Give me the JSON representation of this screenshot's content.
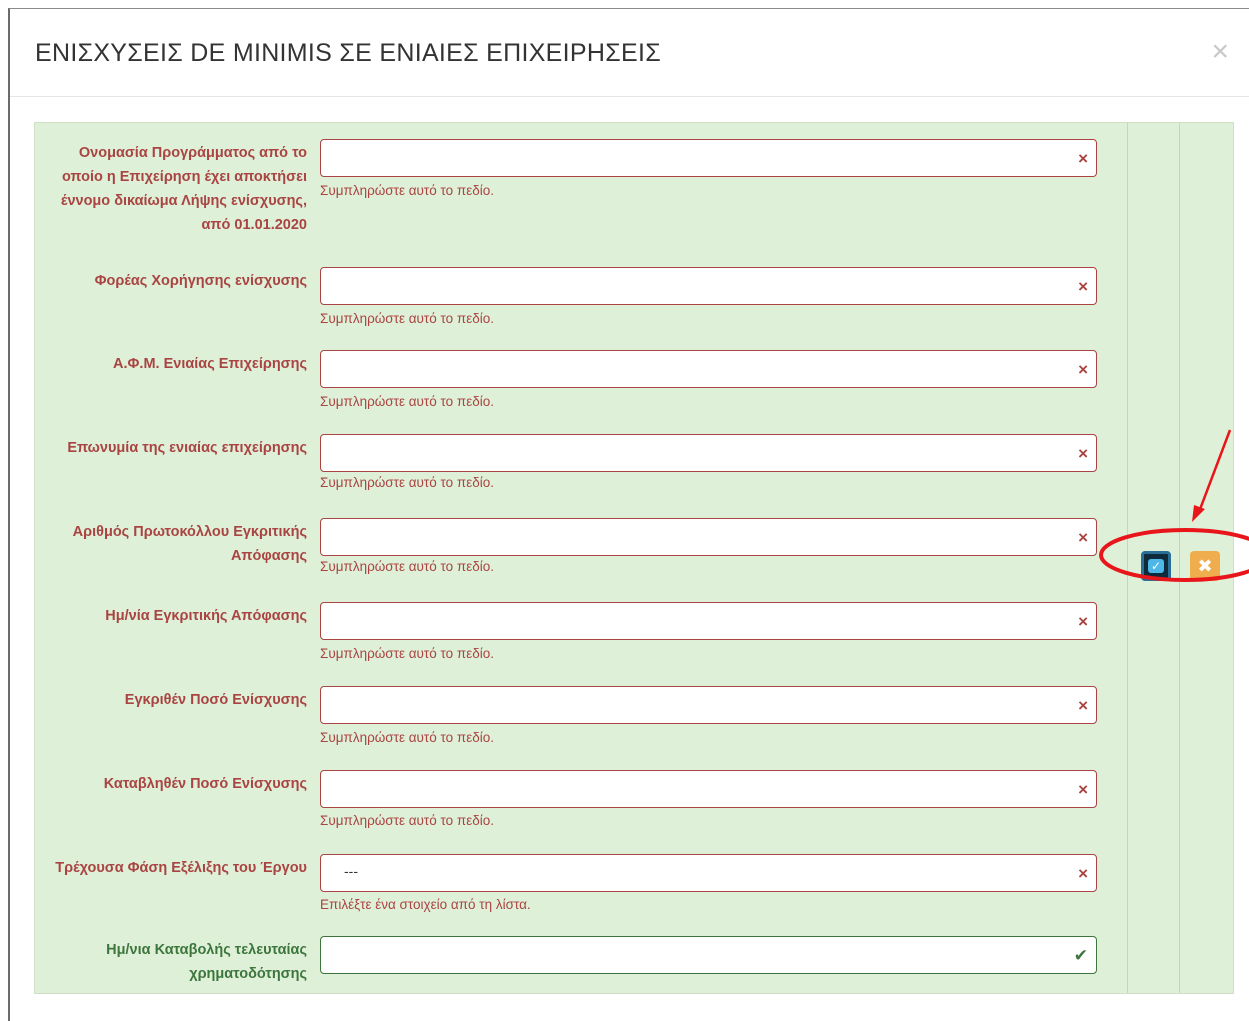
{
  "modal": {
    "title": "ΕΝΙΣΧΥΣΕΙΣ DE MINIMIS ΣΕ ΕΝΙΑΙΕΣ ΕΠΙΧΕΙΡΗΣΕΙΣ",
    "close_label": "×"
  },
  "fields": [
    {
      "label": "Ονομασία Προγράμματος από το οποίο η Επιχείρηση έχει αποκτήσει έννομο δικαίωμα Λήψης ενίσχυσης, από 01.01.2020",
      "value": "",
      "help": "Συμπληρώστε αυτό το πεδίο.",
      "state": "error"
    },
    {
      "label": "Φορέας Χορήγησης ενίσχυσης",
      "value": "",
      "help": "Συμπληρώστε αυτό το πεδίο.",
      "state": "error"
    },
    {
      "label": "Α.Φ.Μ. Ενιαίας Επιχείρησης",
      "value": "",
      "help": "Συμπληρώστε αυτό το πεδίο.",
      "state": "error"
    },
    {
      "label": "Επωνυμία της ενιαίας επιχείρησης",
      "value": "",
      "help": "Συμπληρώστε αυτό το πεδίο.",
      "state": "error"
    },
    {
      "label": "Αριθμός Πρωτοκόλλου Εγκριτικής Απόφασης",
      "value": "",
      "help": "Συμπληρώστε αυτό το πεδίο.",
      "state": "error"
    },
    {
      "label": "Ημ/νία Εγκριτικής Απόφασης",
      "value": "",
      "help": "Συμπληρώστε αυτό το πεδίο.",
      "state": "error"
    },
    {
      "label": "Εγκριθέν Ποσό Ενίσχυσης",
      "value": "",
      "help": "Συμπληρώστε αυτό το πεδίο.",
      "state": "error"
    },
    {
      "label": "Καταβληθέν Ποσό Ενίσχυσης",
      "value": "",
      "help": "Συμπληρώστε αυτό το πεδίο.",
      "state": "error"
    },
    {
      "label": "Τρέχουσα Φάση Εξέλιξης του Έργου",
      "value": "---",
      "help": "Επιλέξτε ένα στοιχείο από τη λίστα.",
      "state": "error"
    },
    {
      "label": "Ημ/νια Καταβολής τελευταίας χρηματοδότησης",
      "value": "",
      "help": "",
      "state": "success"
    }
  ],
  "icons": {
    "error": "×",
    "success": "✔",
    "edit": "✓",
    "remove": "✖"
  },
  "colors": {
    "panel_bg": "#dff0d8",
    "error": "#a94442",
    "success": "#3c763d",
    "remove_button": "#f0ad4e",
    "edit_button": "#4db8e8"
  }
}
